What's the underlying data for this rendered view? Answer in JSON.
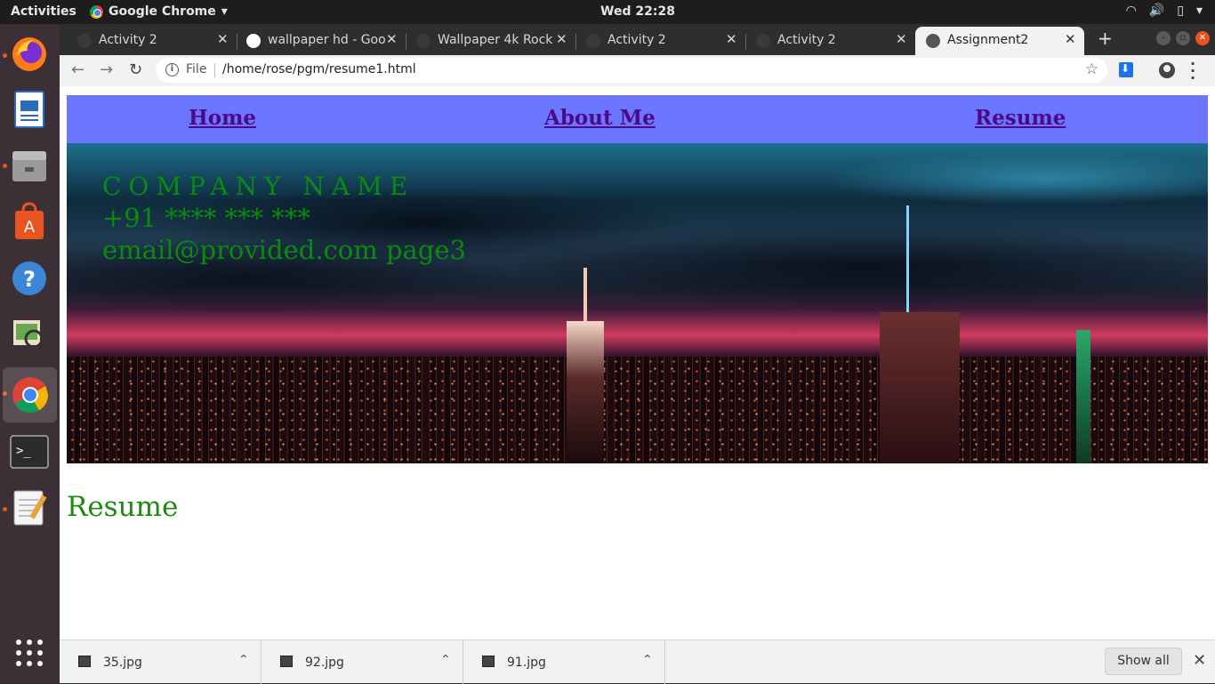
{
  "system_bar": {
    "activities": "Activities",
    "app_name": "Google Chrome",
    "clock": "Wed 22:28"
  },
  "browser": {
    "tabs": [
      {
        "title": "Activity 2",
        "active": false
      },
      {
        "title": "wallpaper hd - Goo",
        "active": false
      },
      {
        "title": "Wallpaper 4k Rock",
        "active": false
      },
      {
        "title": "Activity 2",
        "active": false
      },
      {
        "title": "Activity 2",
        "active": false
      },
      {
        "title": "Assignment2",
        "active": true
      }
    ],
    "new_tab": "+",
    "omnibox": {
      "scheme_label": "File",
      "url": "/home/rose/pgm/resume1.html"
    }
  },
  "page": {
    "nav": {
      "home": "Home",
      "about": "About Me",
      "resume": "Resume"
    },
    "hero": {
      "company": "COMPANY NAME",
      "phone": "+91 **** *** ***",
      "email": "email@provided.com page3"
    },
    "section_heading": "Resume"
  },
  "downloads": {
    "items": [
      {
        "name": "35.jpg"
      },
      {
        "name": "92.jpg"
      },
      {
        "name": "91.jpg"
      }
    ],
    "show_all": "Show all"
  },
  "dock": {
    "icons": [
      "firefox-icon",
      "libreoffice-writer-icon",
      "files-icon",
      "software-center-icon",
      "help-icon",
      "image-viewer-icon",
      "chrome-icon",
      "terminal-icon",
      "text-editor-icon",
      "show-apps-icon"
    ]
  },
  "colors": {
    "nav_bg": "#6b75ff",
    "nav_link": "#4b0b86",
    "hero_text": "#0a8a10",
    "heading_text": "#1a8a10",
    "dock_bg": "#3c2f36",
    "ubuntu_orange": "#e95420"
  }
}
